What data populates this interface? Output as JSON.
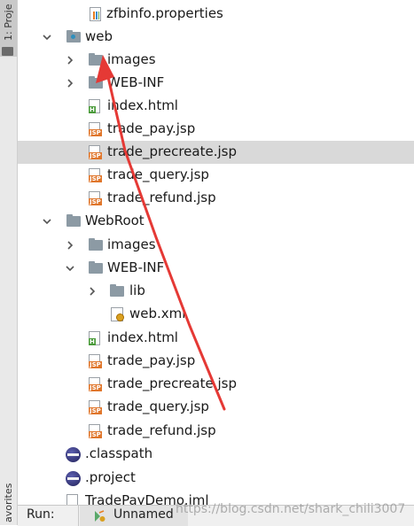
{
  "sidebar": {
    "project_tab": "1: Proje",
    "favorites_tab": "avorites"
  },
  "tree": [
    {
      "label": "zfbinfo.properties"
    },
    {
      "label": "web"
    },
    {
      "label": "images"
    },
    {
      "label": "WEB-INF"
    },
    {
      "label": "index.html"
    },
    {
      "label": "trade_pay.jsp"
    },
    {
      "label": "trade_precreate.jsp",
      "selected": true
    },
    {
      "label": "trade_query.jsp"
    },
    {
      "label": "trade_refund.jsp"
    },
    {
      "label": "WebRoot"
    },
    {
      "label": "images"
    },
    {
      "label": "WEB-INF"
    },
    {
      "label": "lib"
    },
    {
      "label": "web.xml"
    },
    {
      "label": "index.html"
    },
    {
      "label": "trade_pay.jsp"
    },
    {
      "label": "trade_precreate.jsp"
    },
    {
      "label": "trade_query.jsp"
    },
    {
      "label": "trade_refund.jsp"
    },
    {
      "label": ".classpath"
    },
    {
      "label": ".project"
    },
    {
      "label": "TradePayDemo.iml"
    }
  ],
  "icons": {
    "jsp_badge": "JSP",
    "html_badge": "H"
  },
  "run": {
    "label": "Run:",
    "tab_label": "Unnamed"
  },
  "watermark": "https://blog.csdn.net/shark_chili3007",
  "colors": {
    "selection": "#d9d9d9",
    "annotation_arrow": "#e53935",
    "jsp_badge": "#e0762b",
    "html_badge": "#4a9b3a"
  }
}
